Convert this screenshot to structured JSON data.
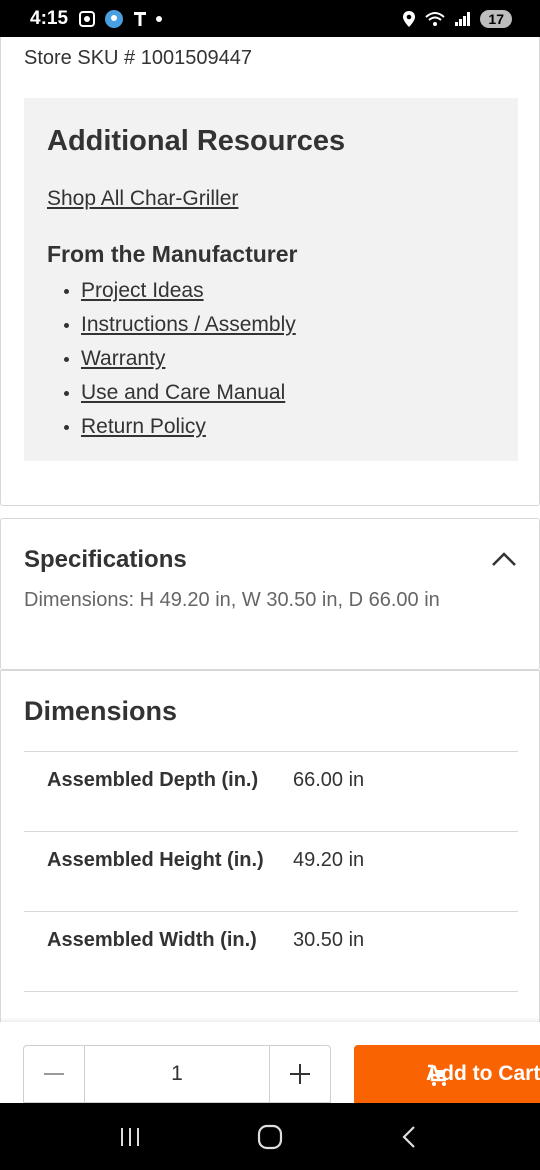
{
  "status_bar": {
    "time": "4:15",
    "battery": "17",
    "icons": [
      "screenshot-icon",
      "location-app-icon",
      "tmobile-icon",
      "dot-icon",
      "location-pin-icon",
      "wifi-icon",
      "signal-icon"
    ]
  },
  "product": {
    "store_sku": "Store SKU # 1001509447"
  },
  "resources": {
    "title": "Additional Resources",
    "shop_link": "Shop All Char-Griller",
    "manufacturer_title": "From the Manufacturer",
    "manufacturer_links": [
      "Project Ideas",
      "Instructions / Assembly",
      "Warranty",
      "Use and Care Manual",
      "Return Policy"
    ]
  },
  "specifications": {
    "title": "Specifications",
    "summary": "Dimensions: H 49.20 in, W 30.50 in, D 66.00 in",
    "expanded": true
  },
  "dimensions": {
    "title": "Dimensions",
    "rows": [
      {
        "label": "Assembled Depth (in.)",
        "value": "66.00 in"
      },
      {
        "label": "Assembled Height (in.)",
        "value": "49.20 in"
      },
      {
        "label": "Assembled Width (in.)",
        "value": "30.50 in"
      }
    ]
  },
  "purchase_bar": {
    "quantity": "1",
    "add_to_cart_label": "Add to Cart",
    "accent_color": "#f96302"
  }
}
